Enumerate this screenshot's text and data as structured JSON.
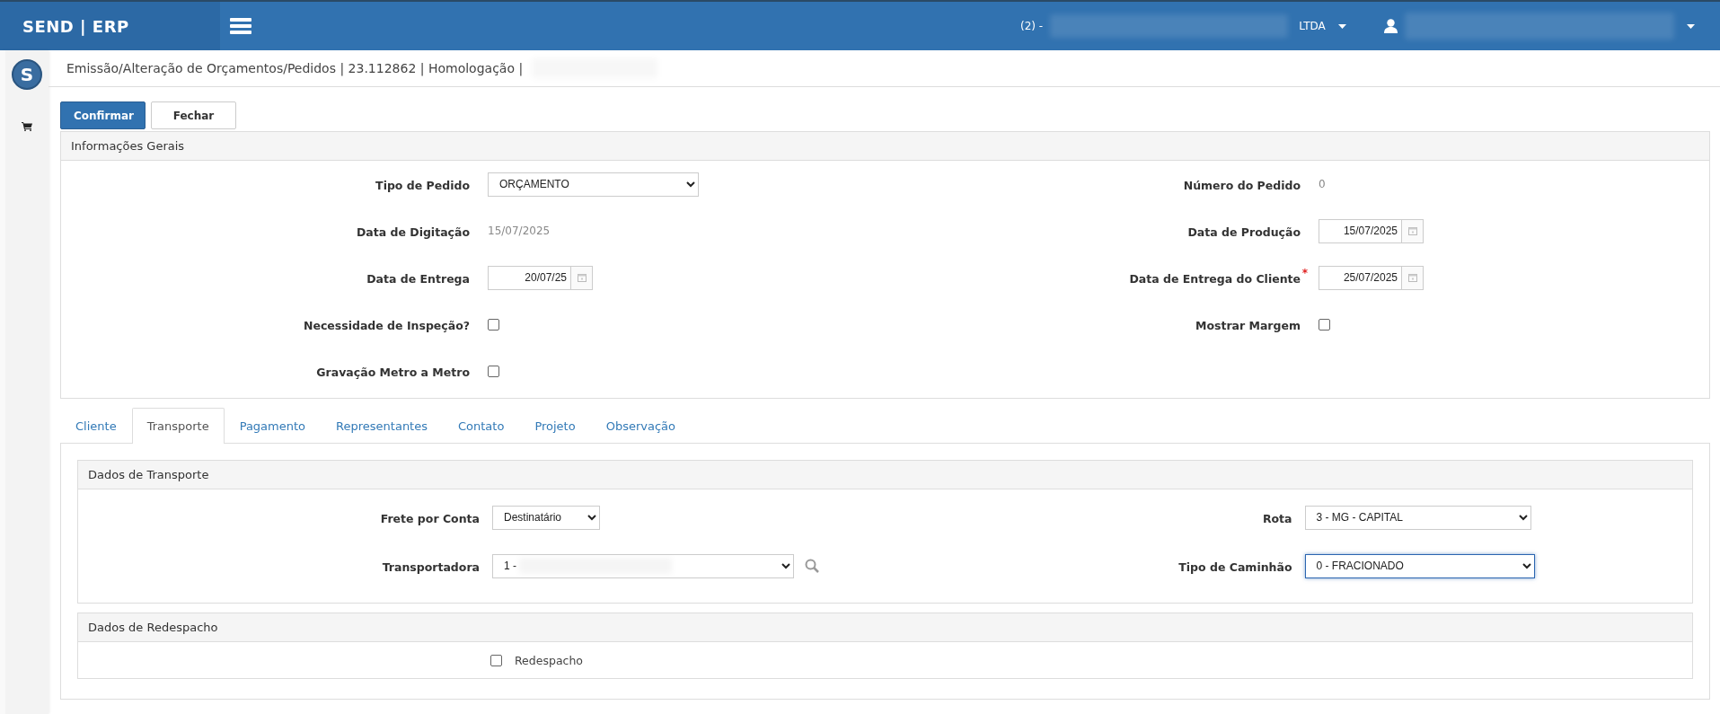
{
  "topbar": {
    "brand": "SEND | ERP",
    "company_prefix": "(2) -",
    "company_suffix": "LTDA"
  },
  "sidebar": {
    "logo_letter": "S"
  },
  "breadcrumb": "Emissão/Alteração de Orçamentos/Pedidos | 23.112862 | Homologação |",
  "buttons": [
    {
      "label": "Confirmar",
      "kind": "primary"
    },
    {
      "label": "Fechar",
      "kind": "default"
    }
  ],
  "general": {
    "title": "Informações Gerais",
    "rows": [
      {
        "left": {
          "kind": "select",
          "label": "Tipo de Pedido",
          "value": "ORÇAMENTO",
          "focused": false
        },
        "right": {
          "kind": "text",
          "label": "Número do Pedido",
          "value": "0"
        }
      },
      {
        "left": {
          "kind": "text",
          "label": "Data de Digitação",
          "value": "15/07/2025"
        },
        "right": {
          "kind": "date",
          "label": "Data de Produção",
          "value": "15/07/2025"
        }
      },
      {
        "left": {
          "kind": "date",
          "label": "Data de Entrega",
          "value": "20/07/25"
        },
        "right": {
          "kind": "date",
          "label": "Data de Entrega do Cliente",
          "required_mark": "*",
          "value": "25/07/2025"
        }
      },
      {
        "left": {
          "kind": "checkbox",
          "label": "Necessidade de Inspeção?",
          "checked": false
        },
        "right": {
          "kind": "checkbox",
          "label": "Mostrar Margem",
          "checked": false
        }
      },
      {
        "left": {
          "kind": "checkbox",
          "label": "Gravação Metro a Metro",
          "checked": false
        },
        "right": null
      }
    ]
  },
  "tabs": [
    {
      "label": "Cliente",
      "selected": false
    },
    {
      "label": "Transporte",
      "selected": true
    },
    {
      "label": "Pagamento",
      "selected": false
    },
    {
      "label": "Representantes",
      "selected": false
    },
    {
      "label": "Contato",
      "selected": false
    },
    {
      "label": "Projeto",
      "selected": false
    },
    {
      "label": "Observação",
      "selected": false
    }
  ],
  "transport": {
    "title": "Dados de Transporte",
    "rows": [
      {
        "left": {
          "kind": "select",
          "label": "Frete por Conta",
          "value": "Destinatário",
          "focused": false
        },
        "right": {
          "kind": "select",
          "label": "Rota",
          "value": "3 - MG - CAPITAL",
          "focused": false
        }
      },
      {
        "left": {
          "kind": "select_search",
          "label": "Transportadora",
          "value": "1 -",
          "focused": false
        },
        "right": {
          "kind": "select",
          "label": "Tipo de Caminhão",
          "value": "0 - FRACIONADO",
          "focused": true
        }
      }
    ]
  },
  "redespacho": {
    "title": "Dados de Redespacho",
    "checkbox": {
      "label": "Redespacho",
      "checked": false
    }
  }
}
